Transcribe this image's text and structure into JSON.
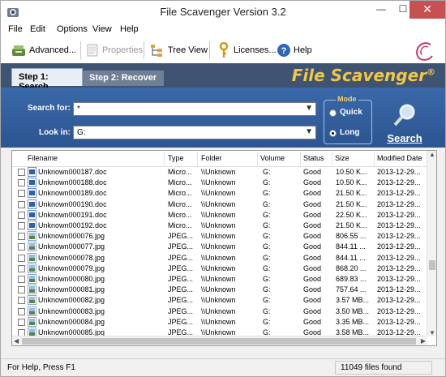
{
  "window": {
    "title": "File Scavenger Version 3.2",
    "controls": [
      "—",
      "☐",
      "✕"
    ]
  },
  "menu": [
    "File",
    "Edit",
    "Options",
    "View",
    "Help"
  ],
  "toolbar": {
    "advanced": "Advanced...",
    "properties": "Properties",
    "tree_view": "Tree View",
    "licenses": "Licenses...",
    "help": "Help"
  },
  "steps": {
    "step1": "Step 1: Search",
    "step2": "Step 2: Recover",
    "brand": "File Scavenger"
  },
  "search": {
    "search_for_label": "Search for:",
    "search_for_value": "*",
    "look_in_label": "Look in:",
    "look_in_value": "G:",
    "mode_title": "Mode",
    "mode_quick": "Quick",
    "mode_long": "Long",
    "mode_selected": "Long",
    "search_button": "Search"
  },
  "table": {
    "columns": [
      "Filename",
      "Type",
      "Folder",
      "Volume",
      "Status",
      "Size",
      "Modified Date"
    ],
    "rows": [
      [
        "Unknown000187.doc",
        "Micro...",
        "\\\\Unknown",
        "G:",
        "Good",
        "10.50 K...",
        "2013-12-29..."
      ],
      [
        "Unknown000188.doc",
        "Micro...",
        "\\\\Unknown",
        "G:",
        "Good",
        "10.50 K...",
        "2013-12-29..."
      ],
      [
        "Unknown000189.doc",
        "Micro...",
        "\\\\Unknown",
        "G:",
        "Good",
        "21.50 K...",
        "2013-12-29..."
      ],
      [
        "Unknown000190.doc",
        "Micro...",
        "\\\\Unknown",
        "G:",
        "Good",
        "21.50 K...",
        "2013-12-29..."
      ],
      [
        "Unknown000191.doc",
        "Micro...",
        "\\\\Unknown",
        "G:",
        "Good",
        "22.50 K...",
        "2013-12-29..."
      ],
      [
        "Unknown000192.doc",
        "Micro...",
        "\\\\Unknown",
        "G:",
        "Good",
        "21.50 K...",
        "2013-12-29..."
      ],
      [
        "Unknown000076.jpg",
        "JPEG...",
        "\\\\Unknown",
        "G:",
        "Good",
        "806.55 ...",
        "2013-12-29..."
      ],
      [
        "Unknown000077.jpg",
        "JPEG...",
        "\\\\Unknown",
        "G:",
        "Good",
        "844.11 ...",
        "2013-12-29..."
      ],
      [
        "Unknown000078.jpg",
        "JPEG...",
        "\\\\Unknown",
        "G:",
        "Good",
        "844.11 ...",
        "2013-12-29..."
      ],
      [
        "Unknown000079.jpg",
        "JPEG...",
        "\\\\Unknown",
        "G:",
        "Good",
        "868.20 ...",
        "2013-12-29..."
      ],
      [
        "Unknown000080.jpg",
        "JPEG...",
        "\\\\Unknown",
        "G:",
        "Good",
        "689.83 ...",
        "2013-12-29..."
      ],
      [
        "Unknown000081.jpg",
        "JPEG...",
        "\\\\Unknown",
        "G:",
        "Good",
        "757.64 ...",
        "2013-12-29..."
      ],
      [
        "Unknown000082.jpg",
        "JPEG...",
        "\\\\Unknown",
        "G:",
        "Good",
        "3.57 MB...",
        "2013-12-29..."
      ],
      [
        "Unknown000083.jpg",
        "JPEG...",
        "\\\\Unknown",
        "G:",
        "Good",
        "3.50 MB...",
        "2013-12-29..."
      ],
      [
        "Unknown000084.jpg",
        "JPEG...",
        "\\\\Unknown",
        "G:",
        "Good",
        "3.35 MB...",
        "2013-12-29..."
      ],
      [
        "Unknown000085.jpg",
        "JPEG...",
        "\\\\Unknown",
        "G:",
        "Good",
        "3.58 MB...",
        "2013-12-29..."
      ]
    ]
  },
  "status": {
    "left": "For Help, Press F1",
    "right": "11049 files found"
  },
  "colors": {
    "panel_blue": "#2f5b98",
    "header_dark": "#3f5472",
    "brand_yellow": "#f2c744",
    "close_red": "#c75050"
  }
}
